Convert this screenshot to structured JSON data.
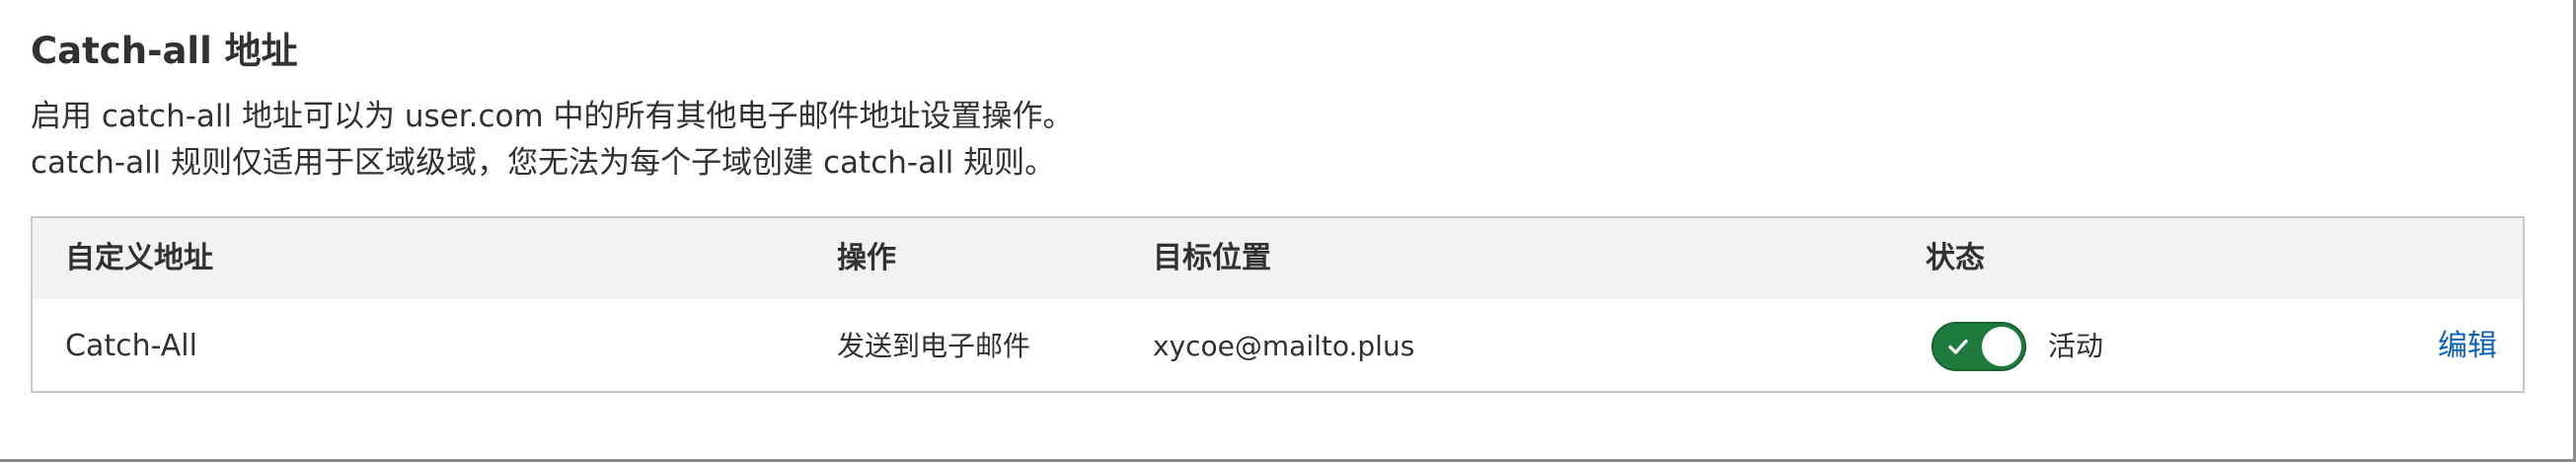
{
  "header": {
    "title": "Catch-all 地址",
    "description_line1": "启用 catch-all 地址可以为 user.com 中的所有其他电子邮件地址设置操作。",
    "description_line2": "catch-all 规则仅适用于区域级域，您无法为每个子域创建 catch-all 规则。"
  },
  "table": {
    "columns": [
      "自定义地址",
      "操作",
      "目标位置",
      "状态"
    ],
    "rows": [
      {
        "address": "Catch-All",
        "action": "发送到电子邮件",
        "destination": "xycoe@mailto.plus",
        "status_enabled": true,
        "status_label": "活动",
        "edit_label": "编辑"
      }
    ]
  },
  "icons": {
    "toggle_check": "check-icon"
  },
  "colors": {
    "toggle_on": "#1f7a3e",
    "link": "#0b62b5",
    "header_bg": "#f2f2f2",
    "border": "#c9c9c9"
  }
}
